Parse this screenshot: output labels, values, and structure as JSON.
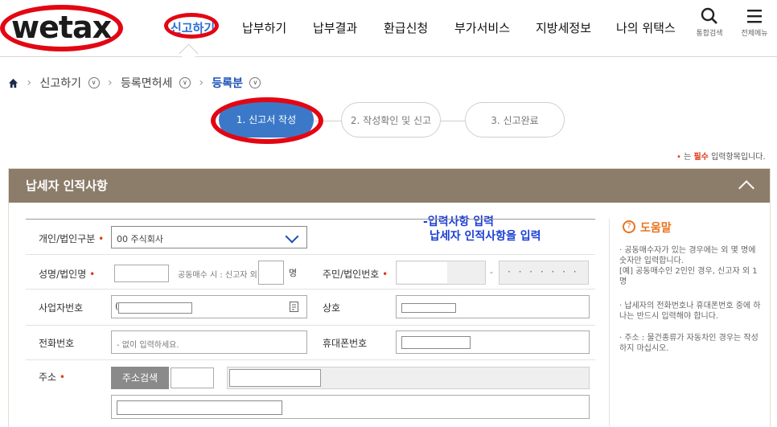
{
  "header": {
    "logo_text": "wetax",
    "nav": [
      {
        "label": "신고하기",
        "active": true
      },
      {
        "label": "납부하기"
      },
      {
        "label": "납부결과"
      },
      {
        "label": "환급신청"
      },
      {
        "label": "부가서비스"
      },
      {
        "label": "지방세정보"
      },
      {
        "label": "나의 위택스"
      }
    ],
    "search_label": "통합검색",
    "menu_label": "전체메뉴",
    "highlight_color": "#e30613"
  },
  "breadcrumb": {
    "items": [
      "신고하기",
      "등록면허세",
      "등록분"
    ]
  },
  "steps": [
    "1. 신고서 작성",
    "2. 작성확인 및 신고",
    "3. 신고완료"
  ],
  "required_note": {
    "bullet": "•",
    "prefix": "는",
    "emphasis": "필수",
    "suffix": "입력항목입니다."
  },
  "section": {
    "title": "납세자 인적사항",
    "overlay_note_line1": "-입력사항 입력",
    "overlay_note_line2": "납세자 인적사항을 입력"
  },
  "form": {
    "type_label": "개인/법인구분",
    "type_value": "00 주식회사",
    "name_label": "성명/법인명",
    "joint_text": "공동매수 시 : 신고자 외",
    "joint_unit": "명",
    "id_label": "주민/법인번호",
    "id_dash": "-",
    "id_mask": "· · · · · · ·",
    "bizno_label": "사업자번호",
    "bizno_value": "(",
    "company_label": "상호",
    "phone_label": "전화번호",
    "phone_placeholder": "- 없이 입력하세요.",
    "mobile_label": "휴대폰번호",
    "address_label": "주소",
    "address_button": "주소검색",
    "required_mark": "•"
  },
  "help": {
    "title": "도움말",
    "icon_char": "?",
    "items": [
      "· 공동매수자가 있는 경우에는 외 몇 명에 숫자만 입력합니다.\n[예] 공동매수인 2인인 경우, 신고자 외 1명",
      "· 납세자의 전화번호나 휴대폰번호 중에 하나는 반드시 입력해야 합니다.",
      "· 주소 : 물건종류가 자동차인 경우는 작성하지 마십시오."
    ]
  }
}
